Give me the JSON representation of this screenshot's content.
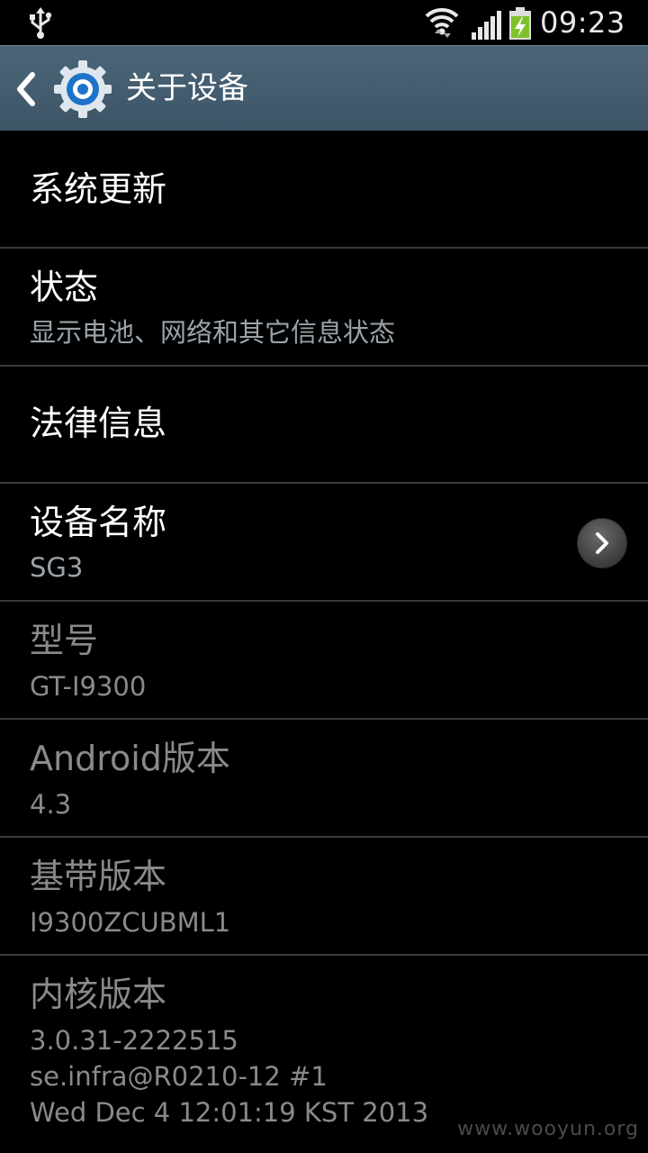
{
  "status_bar": {
    "time": "09:23",
    "icons": [
      "usb-icon",
      "wifi-icon",
      "signal-icon",
      "battery-charging-icon"
    ]
  },
  "action_bar": {
    "title": "关于设备",
    "back_icon": "back-arrow-icon",
    "app_icon": "settings-gear-icon"
  },
  "items": [
    {
      "title": "系统更新"
    },
    {
      "title": "状态",
      "subtitle": "显示电池、网络和其它信息状态"
    },
    {
      "title": "法律信息"
    },
    {
      "title": "设备名称",
      "subtitle": "SG3",
      "action_icon": "chevron-right-icon"
    },
    {
      "title": "型号",
      "subtitle": "GT-I9300"
    },
    {
      "title": "Android版本",
      "subtitle": "4.3"
    },
    {
      "title": "基带版本",
      "subtitle": "I9300ZCUBML1"
    },
    {
      "title": "内核版本",
      "subtitle_lines": [
        "3.0.31-2222515",
        "se.infra@R0210-12 #1",
        "Wed Dec 4 12:01:19 KST 2013"
      ]
    }
  ],
  "watermark": "www.wooyun.org",
  "colors": {
    "action_bar": "#466072",
    "background": "#000000",
    "title_text": "#ffffff",
    "subtitle_text": "#9aa3a9",
    "disabled_text": "#8a8a8a",
    "divider": "#3a3a3a"
  }
}
